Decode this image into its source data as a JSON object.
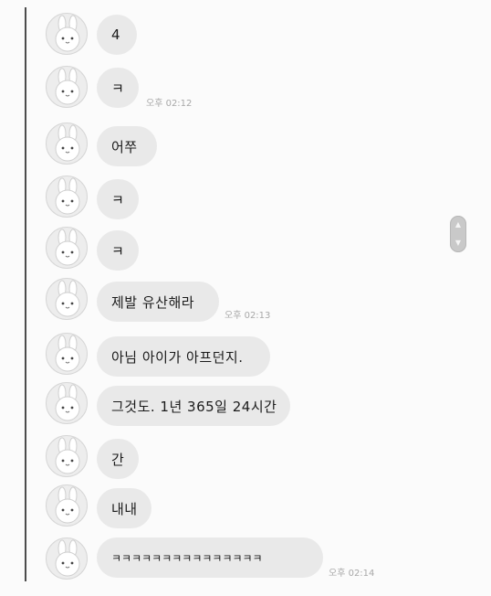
{
  "conversation": {
    "messages": [
      {
        "text": "4",
        "time": ""
      },
      {
        "text": "ㅋ",
        "time": "오후 02:12"
      },
      {
        "text": "어쭈",
        "time": ""
      },
      {
        "text": "ㅋ",
        "time": ""
      },
      {
        "text": "ㅋ",
        "time": ""
      },
      {
        "text": "제발 유산해라",
        "time": "오후 02:13"
      },
      {
        "text": "아님 아이가 아프던지.",
        "time": ""
      },
      {
        "text": "그것도. 1년 365일 24시간",
        "time": ""
      },
      {
        "text": "간",
        "time": ""
      },
      {
        "text": "내내",
        "time": ""
      },
      {
        "text": "ㅋㅋㅋㅋㅋㅋㅋㅋㅋㅋㅋㅋㅋㅋㅋ",
        "time": "오후 02:14"
      }
    ]
  },
  "avatar": {
    "icon": "bunny-icon"
  },
  "scrollbar": {
    "icon_up": "chevron-up-icon",
    "icon_down": "chevron-down-icon"
  }
}
